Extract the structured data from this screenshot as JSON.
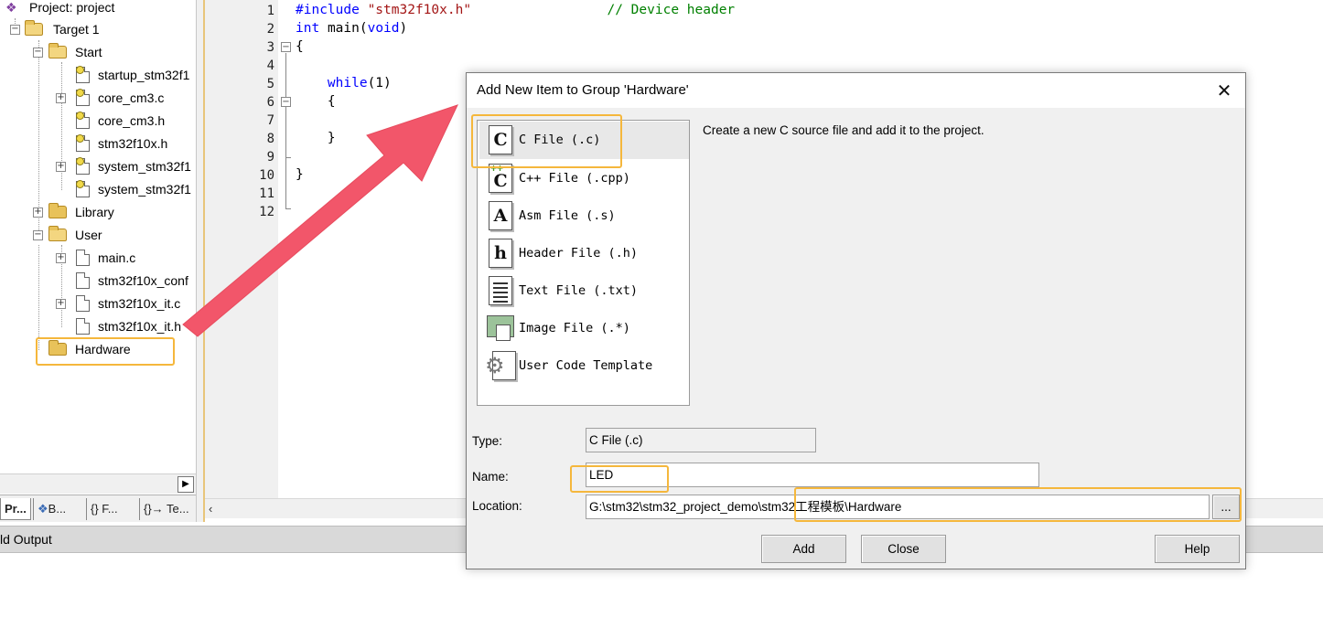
{
  "colors": {
    "highlight": "#f5b73c",
    "arrow": "#f2566a",
    "keyword": "#0000ff",
    "string": "#a31515",
    "comment": "#008000"
  },
  "tree": {
    "project": "Project: project",
    "target": "Target 1",
    "start_group": "Start",
    "start_files": [
      "startup_stm32f1",
      "core_cm3.c",
      "core_cm3.h",
      "stm32f10x.h",
      "system_stm32f1",
      "system_stm32f1"
    ],
    "library_group": "Library",
    "user_group": "User",
    "user_files": [
      "main.c",
      "stm32f10x_conf",
      "stm32f10x_it.c",
      "stm32f10x_it.h"
    ],
    "hardware_group": "Hardware"
  },
  "tabs": [
    "Pr...",
    "B...",
    "{} F...",
    "{}→ Te..."
  ],
  "editor": {
    "line_numbers": [
      "1",
      "2",
      "3",
      "4",
      "5",
      "6",
      "7",
      "8",
      "9",
      "10",
      "11",
      "12"
    ],
    "l1_directive": "#include",
    "l1_string": "\"stm32f10x.h\"",
    "l1_comment": "// Device header",
    "l2_kw1": "int",
    "l2_rest": "main(",
    "l2_kw2": "void",
    "l2_close": ")",
    "l3": "{",
    "l5_kw": "while",
    "l5_rest": "(1)",
    "l6": "{",
    "l8": "}",
    "l10": "}"
  },
  "build_output": {
    "title": "ld Output"
  },
  "dialog": {
    "title": "Add New Item to Group 'Hardware'",
    "close_glyph": "✕",
    "description": "Create a new C source file and add it to the project.",
    "items": [
      {
        "icon": "c",
        "label": "C File (.c)"
      },
      {
        "icon": "C",
        "label": "C++ File (.cpp)"
      },
      {
        "icon": "A",
        "label": "Asm File (.s)"
      },
      {
        "icon": "h",
        "label": "Header File (.h)"
      },
      {
        "icon": "txt",
        "label": "Text File (.txt)"
      },
      {
        "icon": "img",
        "label": "Image File (.*)"
      },
      {
        "icon": "tpl",
        "label": "User Code Template"
      }
    ],
    "type_label": "Type:",
    "type_value": "C File (.c)",
    "name_label": "Name:",
    "name_value": "LED",
    "location_label": "Location:",
    "location_value": "G:\\stm32\\stm32_project_demo\\stm32工程模板\\Hardware",
    "browse_label": "...",
    "add_label": "Add",
    "close_label": "Close",
    "help_label": "Help"
  }
}
